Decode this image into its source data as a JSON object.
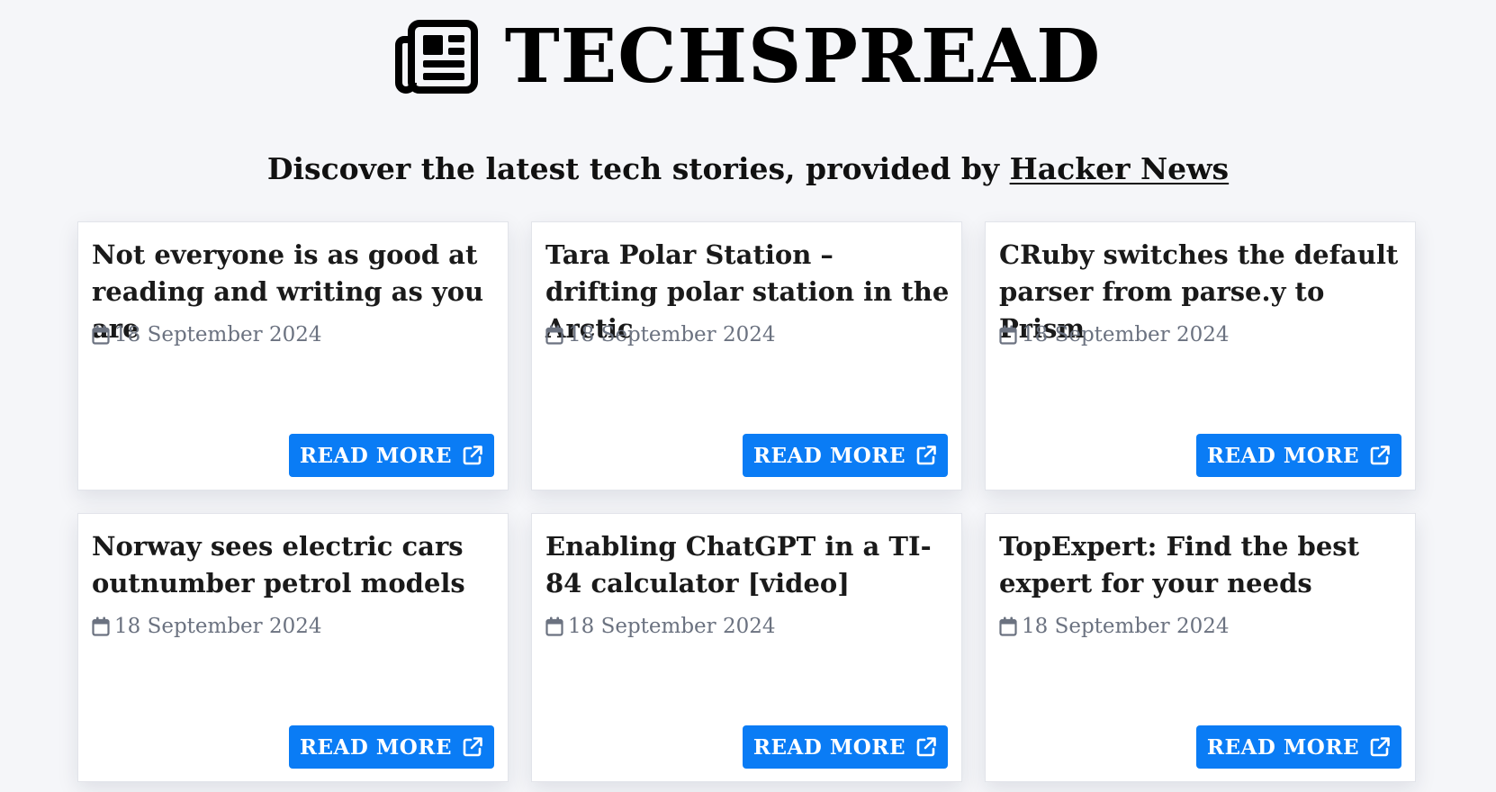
{
  "header": {
    "logo_icon": "newspaper-icon",
    "title": "TECHSPREAD"
  },
  "tagline": {
    "prefix": "Discover the latest tech stories, provided by ",
    "link_label": "Hacker News"
  },
  "colors": {
    "accent": "#0a7cf5",
    "background": "#f5f6f9",
    "date_text": "#6b7280"
  },
  "articles": [
    {
      "title": "Not everyone is as good at reading and writing as you are",
      "date": "18 September 2024",
      "button_label": "READ MORE"
    },
    {
      "title": "Tara Polar Station – drifting polar station in the Arctic",
      "date": "18 September 2024",
      "button_label": "READ MORE"
    },
    {
      "title": "CRuby switches the default parser from parse.y to Prism",
      "date": "18 September 2024",
      "button_label": "READ MORE"
    },
    {
      "title": "Norway sees electric cars outnumber petrol models",
      "date": "18 September 2024",
      "button_label": "READ MORE"
    },
    {
      "title": "Enabling ChatGPT in a TI-84 calculator [video]",
      "date": "18 September 2024",
      "button_label": "READ MORE"
    },
    {
      "title": "TopExpert: Find the best expert for your needs",
      "date": "18 September 2024",
      "button_label": "READ MORE"
    }
  ]
}
